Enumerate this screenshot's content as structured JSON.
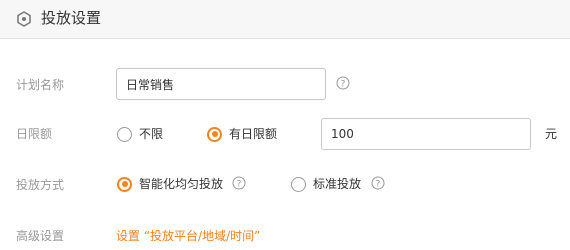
{
  "header": {
    "title": "投放设置",
    "icon": "hexagon-settings-icon"
  },
  "form": {
    "plan_name": {
      "label": "计划名称",
      "value": "日常销售"
    },
    "daily_limit": {
      "label": "日限额",
      "options": [
        "不限",
        "有日限额"
      ],
      "selected": "有日限额",
      "value": "100",
      "unit": "元"
    },
    "delivery_method": {
      "label": "投放方式",
      "options": [
        "智能化均匀投放",
        "标准投放"
      ],
      "selected": "智能化均匀投放"
    },
    "advanced": {
      "label": "高级设置",
      "link": "设置 “投放平台/地域/时间”"
    }
  },
  "colors": {
    "accent": "#f5831f",
    "label": "#999999",
    "header_bg": "#f7f7f7"
  }
}
